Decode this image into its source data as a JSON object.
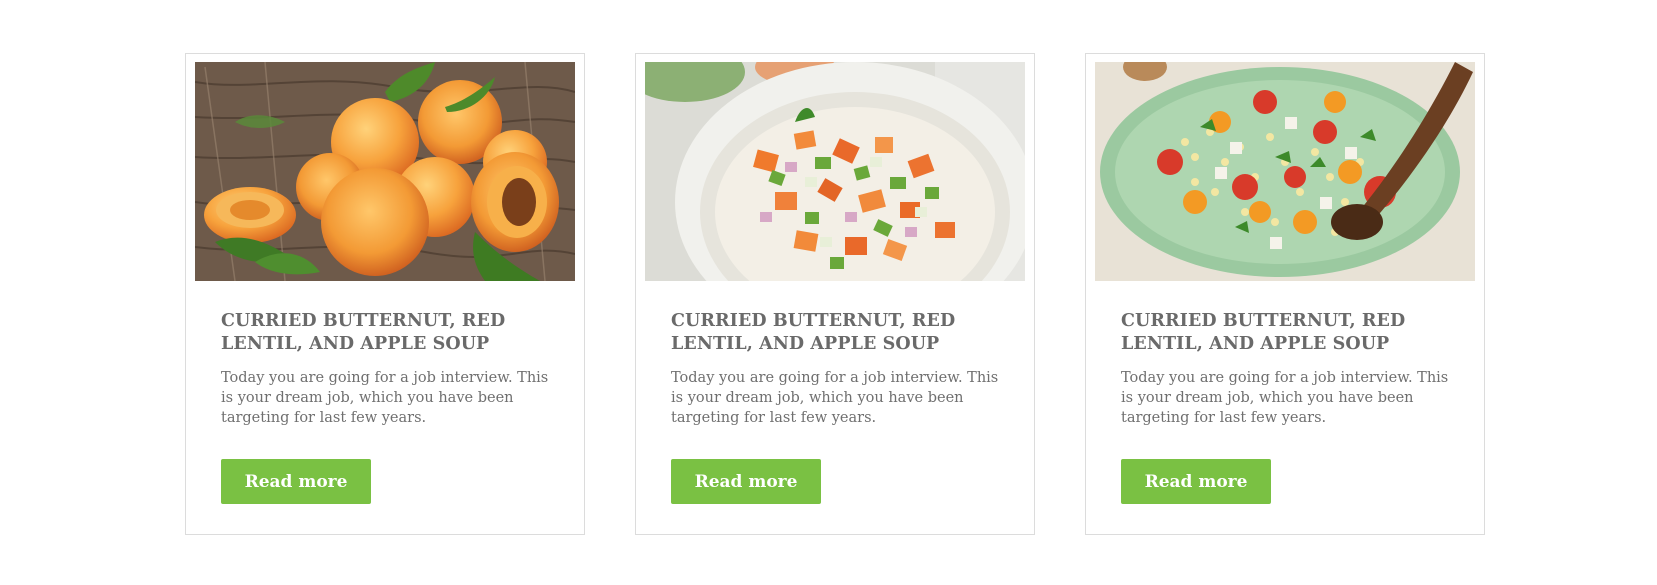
{
  "cards": [
    {
      "image": "apricots-photo",
      "title": "CURRIED BUTTERNUT, RED LENTIL, AND APPLE SOUP",
      "text": "Today you are going for a job interview. This is your dream job, which you have been targeting for last few years.",
      "button": "Read more"
    },
    {
      "image": "chopped-salad-bowl-photo",
      "title": "CURRIED BUTTERNUT, RED LENTIL, AND APPLE SOUP",
      "text": "Today you are going for a job interview. This is your dream job, which you have been targeting for last few years.",
      "button": "Read more"
    },
    {
      "image": "corn-tomato-salad-photo",
      "title": "CURRIED BUTTERNUT, RED LENTIL, AND APPLE SOUP",
      "text": "Today you are going for a job interview. This is your dream job, which you have been targeting for last few years.",
      "button": "Read more"
    }
  ],
  "colors": {
    "button": "#7ac143",
    "title": "#6a6a6a",
    "text": "#6f6f6f",
    "card_border": "#dcdcdc"
  }
}
